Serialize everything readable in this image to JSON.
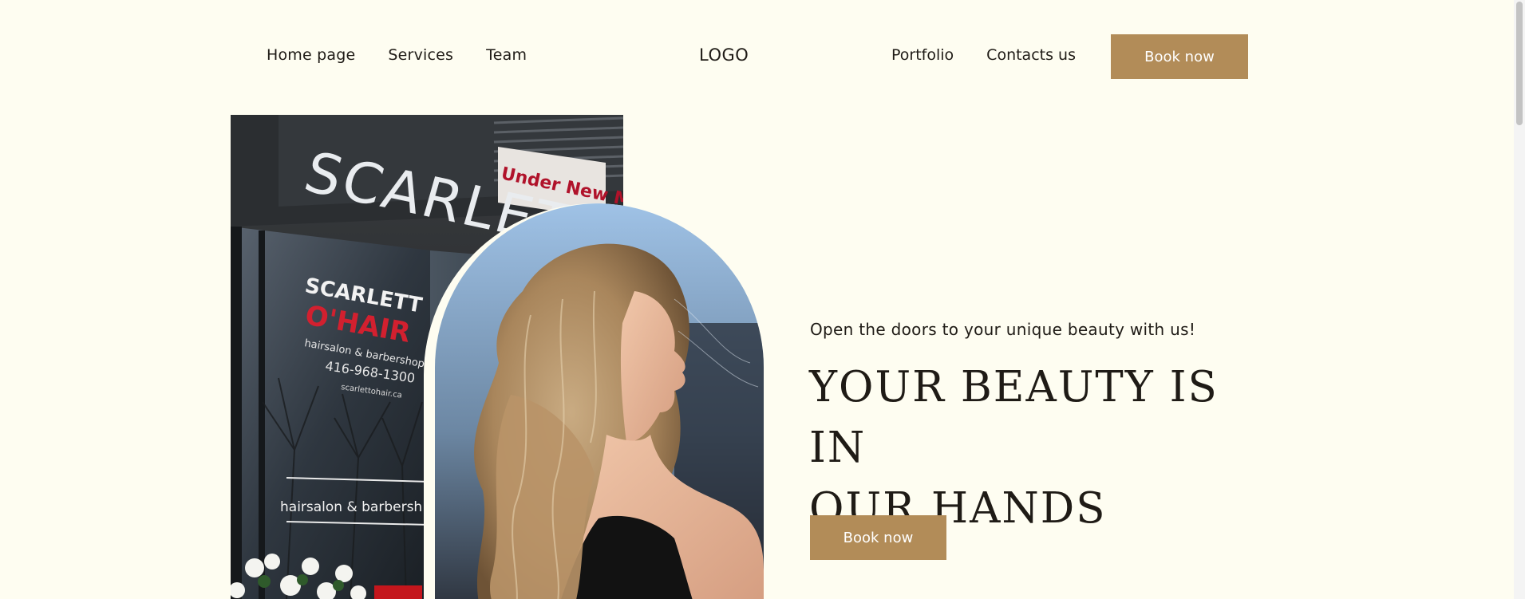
{
  "header": {
    "nav_left": [
      "Home page",
      "Services",
      "Team"
    ],
    "logo": "LOGO",
    "nav_right": [
      "Portfolio",
      "Contacts us"
    ],
    "book_button": "Book now"
  },
  "hero": {
    "tagline": "Open the doors to your unique beauty with us!",
    "headline_line1": "YOUR BEAUTY IS IN",
    "headline_line2": "OUR HANDS",
    "book_button": "Book now",
    "storefront_image": {
      "sign": "SCARLETT",
      "banner": "Under New Mana",
      "window_brand_top": "SCARLETT",
      "window_brand_main": "O'HAIR",
      "window_sub": "hairsalon & barbershop",
      "window_phone": "416-968-1300",
      "window_url": "scarlettohair.ca",
      "window_lower": "hairsalon & barbersh"
    }
  },
  "colors": {
    "background": "#fefdf1",
    "accent": "#b28c58",
    "text": "#1f1b16"
  }
}
